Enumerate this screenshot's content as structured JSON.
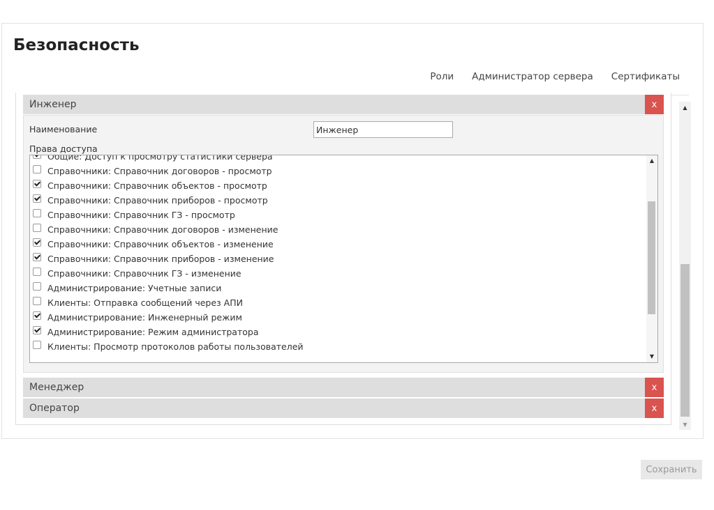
{
  "page_title": "Безопасность",
  "tabs": [
    {
      "label": "Роли",
      "active": true
    },
    {
      "label": "Администратор сервера",
      "active": false
    },
    {
      "label": "Сертификаты",
      "active": false
    }
  ],
  "roles": [
    {
      "name": "Инженер",
      "delete_label": "x",
      "expanded": true,
      "name_field_label": "Наименование",
      "name_field_value": "Инженер",
      "rights_label": "Права доступа",
      "rights": [
        {
          "label": "Общие: Доступ к просмотру статистики сервера",
          "checked": true
        },
        {
          "label": "Справочники: Справочник договоров - просмотр",
          "checked": false
        },
        {
          "label": "Справочники: Справочник объектов - просмотр",
          "checked": true
        },
        {
          "label": "Справочники: Справочник приборов - просмотр",
          "checked": true
        },
        {
          "label": "Справочники: Справочник ГЗ - просмотр",
          "checked": false
        },
        {
          "label": "Справочники: Справочник договоров - изменение",
          "checked": false
        },
        {
          "label": "Справочники: Справочник объектов - изменение",
          "checked": true
        },
        {
          "label": "Справочники: Справочник приборов - изменение",
          "checked": true
        },
        {
          "label": "Справочники: Справочник ГЗ - изменение",
          "checked": false
        },
        {
          "label": "Администрирование: Учетные записи",
          "checked": false
        },
        {
          "label": "Клиенты: Отправка сообщений через АПИ",
          "checked": false
        },
        {
          "label": "Администрирование: Инженерный режим",
          "checked": true
        },
        {
          "label": "Администрирование: Режим администратора",
          "checked": true
        },
        {
          "label": "Клиенты: Просмотр протоколов работы пользователей",
          "checked": false
        }
      ]
    },
    {
      "name": "Менеджер",
      "delete_label": "x",
      "expanded": false
    },
    {
      "name": "Оператор",
      "delete_label": "x",
      "expanded": false
    }
  ],
  "save_label": "Сохранить",
  "colors": {
    "accent": "#d9534f",
    "role_header_bg": "#dedede",
    "save_button_bg": "#e8e8e8"
  }
}
